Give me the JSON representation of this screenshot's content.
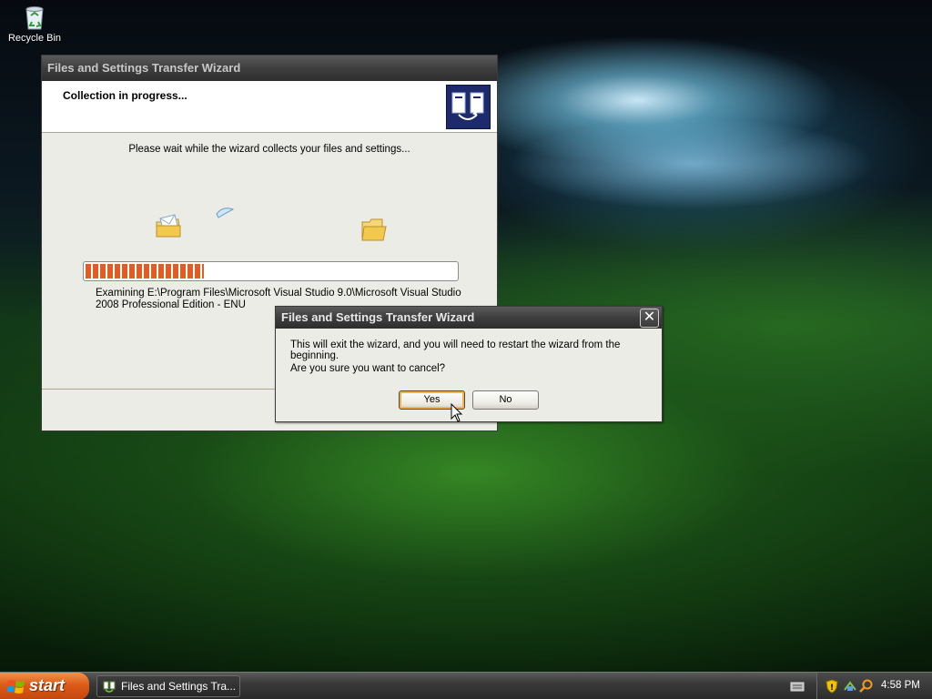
{
  "desktop": {
    "recycle_bin_label": "Recycle Bin"
  },
  "wizard": {
    "title": "Files and Settings Transfer Wizard",
    "heading": "Collection in progress...",
    "wait_text": "Please wait while the wizard collects your files and settings...",
    "progress_fraction": 0.32,
    "examining_text": "Examining E:\\Program Files\\Microsoft Visual Studio 9.0\\Microsoft Visual Studio 2008 Professional Edition - ENU"
  },
  "dialog": {
    "title": "Files and Settings Transfer Wizard",
    "message": "This will exit the wizard, and you will need to restart the wizard from the beginning.",
    "question": "Are you sure you want to cancel?",
    "yes_label": "Yes",
    "no_label": "No",
    "close_glyph": "✕"
  },
  "taskbar": {
    "start_label": "start",
    "task_label": "Files and Settings Tra...",
    "clock": "4:58 PM"
  },
  "colors": {
    "progress": "#e25d22",
    "start_button": "#dd5a17",
    "titlebar": "#3e3e3e",
    "default_button_highlight": "#f3b34a"
  }
}
